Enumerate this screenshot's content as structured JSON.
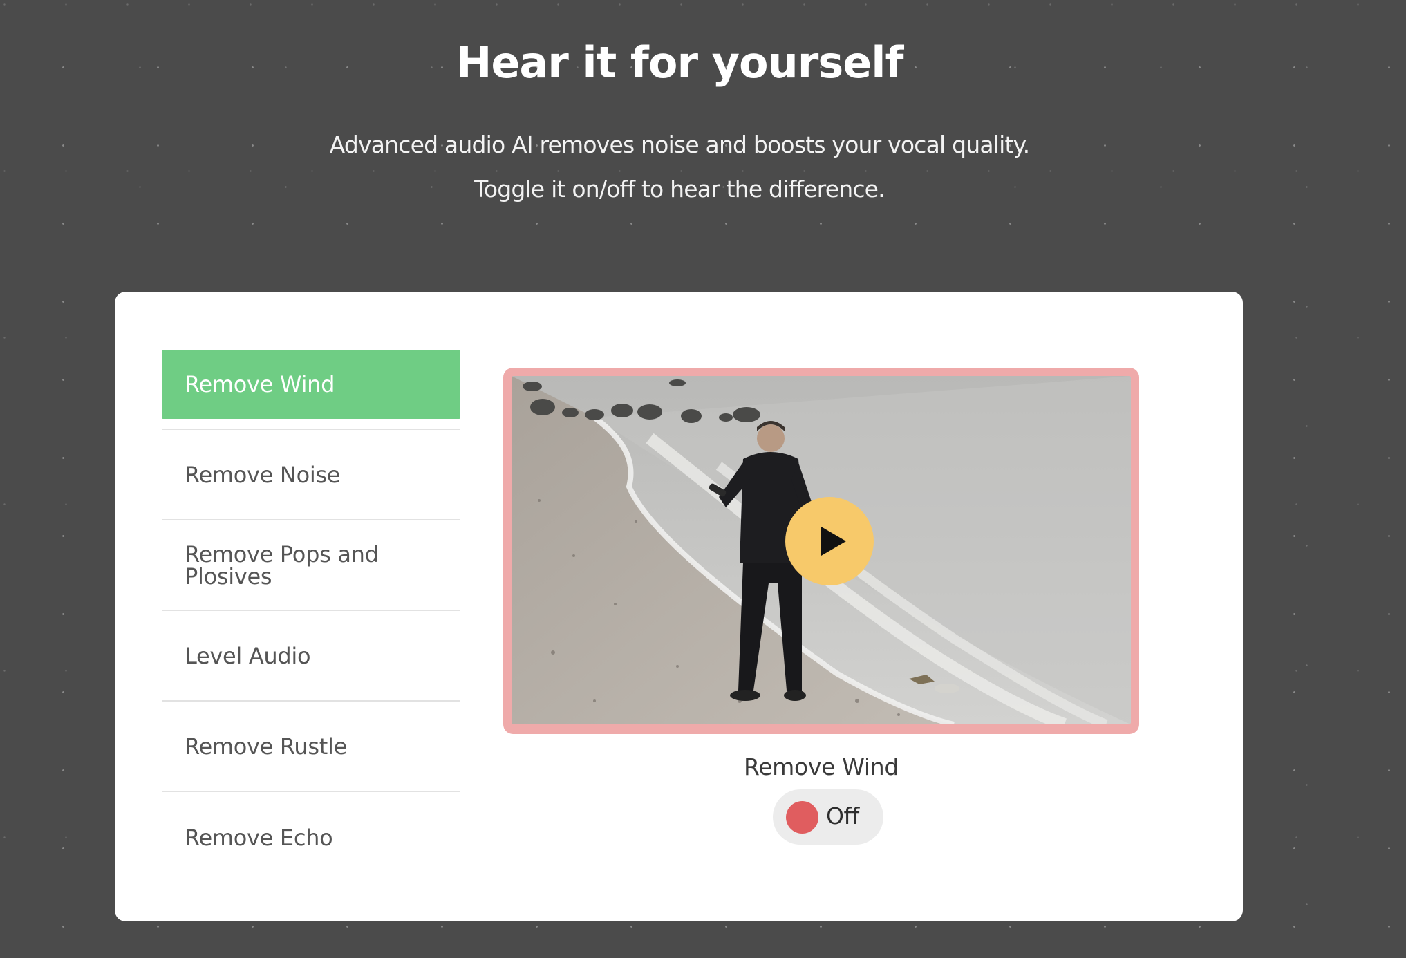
{
  "hero": {
    "title": "Hear it for yourself",
    "subtitle_line1": "Advanced audio AI removes noise and boosts your vocal quality.",
    "subtitle_line2": "Toggle it on/off to hear the difference."
  },
  "features": [
    {
      "label": "Remove Wind",
      "active": true
    },
    {
      "label": "Remove Noise",
      "active": false
    },
    {
      "label": "Remove Pops and Plosives",
      "active": false
    },
    {
      "label": "Level Audio",
      "active": false
    },
    {
      "label": "Remove Rustle",
      "active": false
    },
    {
      "label": "Remove Echo",
      "active": false
    }
  ],
  "player": {
    "play_icon": "play-icon",
    "current_feature": "Remove Wind",
    "toggle": {
      "state": "Off",
      "on": false,
      "knob_color": "#e05d5f"
    }
  },
  "colors": {
    "page_background": "#4b4b4b",
    "active_item": "#6fcd84",
    "video_border": "#efaaaa",
    "play_button": "#f7c96a"
  }
}
